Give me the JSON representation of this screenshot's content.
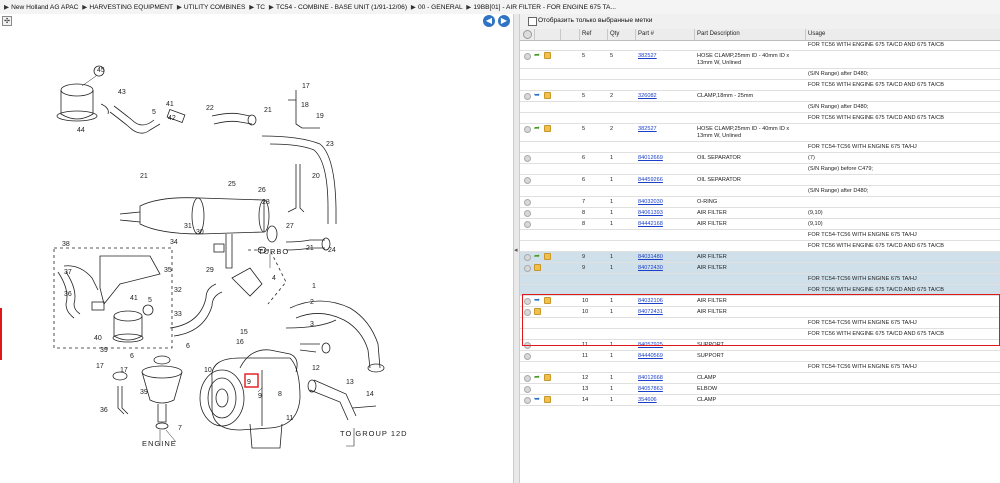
{
  "breadcrumb": {
    "items": [
      "New Holland AG APAC",
      "HARVESTING EQUIPMENT",
      "UTILITY COMBINES",
      "TC",
      "TC54 - COMBINE - BASE UNIT (1/91-12/06)",
      "00 - GENERAL",
      "19BB[01] - AIR FILTER - FOR ENGINE 675 TA..."
    ]
  },
  "filter": {
    "label": "Отобразить только выбранные метки"
  },
  "columns": {
    "ref": "Ref",
    "qty": "Qty",
    "part": "Part #",
    "desc": "Part Description",
    "usage": "Usage"
  },
  "diagram": {
    "labels": {
      "engine": "ENGINE",
      "turbo": "TURBO",
      "to_group": "TO GROUP 12D"
    },
    "numbers": [
      "45",
      "43",
      "44",
      "41",
      "42",
      "5",
      "22",
      "21",
      "17",
      "18",
      "19",
      "23",
      "21",
      "20",
      "25",
      "26",
      "28",
      "31",
      "30",
      "27",
      "21",
      "24",
      "32",
      "38",
      "37",
      "36",
      "34",
      "35",
      "33",
      "29",
      "5",
      "41",
      "6",
      "40",
      "39",
      "4",
      "1",
      "2",
      "3",
      "15",
      "16",
      "12",
      "13",
      "14",
      "11",
      "10",
      "8",
      "9",
      "7",
      "6",
      "17",
      "17",
      "39",
      "36"
    ],
    "highlight": "9"
  },
  "table": {
    "rows": [
      {
        "icons": "none",
        "ref": "",
        "qty": "",
        "part": "",
        "desc": "",
        "usage": "FOR TC56 WITH ENGINE 675 TA/CD AND 675 TA/CB",
        "h": 11
      },
      {
        "icons": "green",
        "ref": "5",
        "qty": "5",
        "part": "382527",
        "desc": "HOSE CLAMP,25mm ID - 40mm ID x 13mm W, Unlined",
        "usage": "",
        "h": 18
      },
      {
        "icons": "none",
        "ref": "",
        "qty": "",
        "part": "",
        "desc": "",
        "usage": "(S/N Range) after D480;",
        "h": 11
      },
      {
        "icons": "none",
        "ref": "",
        "qty": "",
        "part": "",
        "desc": "",
        "usage": "FOR TC56 WITH ENGINE 675 TA/CD AND 675 TA/CB",
        "h": 11
      },
      {
        "icons": "blue",
        "ref": "5",
        "qty": "2",
        "part": "326082",
        "desc": "CLAMP,18mm - 25mm",
        "usage": "",
        "h": 11
      },
      {
        "icons": "none",
        "ref": "",
        "qty": "",
        "part": "",
        "desc": "",
        "usage": "(S/N Range) after D480;",
        "h": 11
      },
      {
        "icons": "none",
        "ref": "",
        "qty": "",
        "part": "",
        "desc": "",
        "usage": "FOR TC56 WITH ENGINE 675 TA/CD AND 675 TA/CB",
        "h": 11
      },
      {
        "icons": "green",
        "ref": "5",
        "qty": "2",
        "part": "382527",
        "desc": "HOSE CLAMP,25mm ID - 40mm ID x 13mm W, Unlined",
        "usage": "",
        "h": 18
      },
      {
        "icons": "none",
        "ref": "",
        "qty": "",
        "part": "",
        "desc": "",
        "usage": "FOR TC54-TC56 WITH ENGINE 675 TA/HJ",
        "h": 11
      },
      {
        "icons": "plain",
        "ref": "6",
        "qty": "1",
        "part": "84012669",
        "desc": "OIL SEPARATOR",
        "usage": "(7)",
        "h": 11
      },
      {
        "icons": "none",
        "ref": "",
        "qty": "",
        "part": "",
        "desc": "",
        "usage": "(S/N Range) before C479;",
        "h": 11
      },
      {
        "icons": "plain",
        "ref": "6",
        "qty": "1",
        "part": "84459266",
        "desc": "OIL SEPARATOR",
        "usage": "",
        "h": 11
      },
      {
        "icons": "none",
        "ref": "",
        "qty": "",
        "part": "",
        "desc": "",
        "usage": "(S/N Range) after D480;",
        "h": 11
      },
      {
        "icons": "plain",
        "ref": "7",
        "qty": "1",
        "part": "84032030",
        "desc": "O-RING",
        "usage": "",
        "h": 11
      },
      {
        "icons": "plain",
        "ref": "8",
        "qty": "1",
        "part": "84061393",
        "desc": "AIR FILTER",
        "usage": "(9,10)",
        "h": 11
      },
      {
        "icons": "plain",
        "ref": "8",
        "qty": "1",
        "part": "84442168",
        "desc": "AIR FILTER",
        "usage": "(9,10)",
        "h": 11
      },
      {
        "icons": "none",
        "ref": "",
        "qty": "",
        "part": "",
        "desc": "",
        "usage": "FOR TC54-TC56 WITH ENGINE 675 TA/HJ",
        "h": 11
      },
      {
        "icons": "none",
        "ref": "",
        "qty": "",
        "part": "",
        "desc": "",
        "usage": "FOR TC56 WITH ENGINE 675 TA/CD AND 675 TA/CB",
        "h": 11
      },
      {
        "icons": "green",
        "ref": "9",
        "qty": "1",
        "part": "84031480",
        "desc": "AIR FILTER",
        "usage": "",
        "h": 11,
        "sel": true
      },
      {
        "icons": "box",
        "ref": "9",
        "qty": "1",
        "part": "84072430",
        "desc": "AIR FILTER",
        "usage": "",
        "h": 11,
        "sel": true
      },
      {
        "icons": "none",
        "ref": "",
        "qty": "",
        "part": "",
        "desc": "",
        "usage": "FOR TC54-TC56 WITH ENGINE 675 TA/HJ",
        "h": 11,
        "sel": true
      },
      {
        "icons": "none",
        "ref": "",
        "qty": "",
        "part": "",
        "desc": "",
        "usage": "FOR TC56 WITH ENGINE 675 TA/CD AND 675 TA/CB",
        "h": 11,
        "sel": true
      },
      {
        "icons": "blue",
        "ref": "10",
        "qty": "1",
        "part": "84032106",
        "desc": "AIR FILTER",
        "usage": "",
        "h": 11
      },
      {
        "icons": "box",
        "ref": "10",
        "qty": "1",
        "part": "84072431",
        "desc": "AIR FILTER",
        "usage": "",
        "h": 11
      },
      {
        "icons": "none",
        "ref": "",
        "qty": "",
        "part": "",
        "desc": "",
        "usage": "FOR TC54-TC56 WITH ENGINE 675 TA/HJ",
        "h": 11
      },
      {
        "icons": "none",
        "ref": "",
        "qty": "",
        "part": "",
        "desc": "",
        "usage": "FOR TC56 WITH ENGINE 675 TA/CD AND 675 TA/CB",
        "h": 11
      },
      {
        "icons": "plain",
        "ref": "11",
        "qty": "1",
        "part": "84057925",
        "desc": "SUPPORT",
        "usage": "",
        "h": 11
      },
      {
        "icons": "plain",
        "ref": "11",
        "qty": "1",
        "part": "84440569",
        "desc": "SUPPORT",
        "usage": "",
        "h": 11
      },
      {
        "icons": "none",
        "ref": "",
        "qty": "",
        "part": "",
        "desc": "",
        "usage": "FOR TC54-TC56 WITH ENGINE 675 TA/HJ",
        "h": 11
      },
      {
        "icons": "green",
        "ref": "12",
        "qty": "1",
        "part": "84012668",
        "desc": "CLAMP",
        "usage": "",
        "h": 11
      },
      {
        "icons": "plain",
        "ref": "13",
        "qty": "1",
        "part": "84057863",
        "desc": "ELBOW",
        "usage": "",
        "h": 11
      },
      {
        "icons": "blue",
        "ref": "14",
        "qty": "1",
        "part": "354606",
        "desc": "CLAMP",
        "usage": "",
        "h": 11
      }
    ]
  }
}
